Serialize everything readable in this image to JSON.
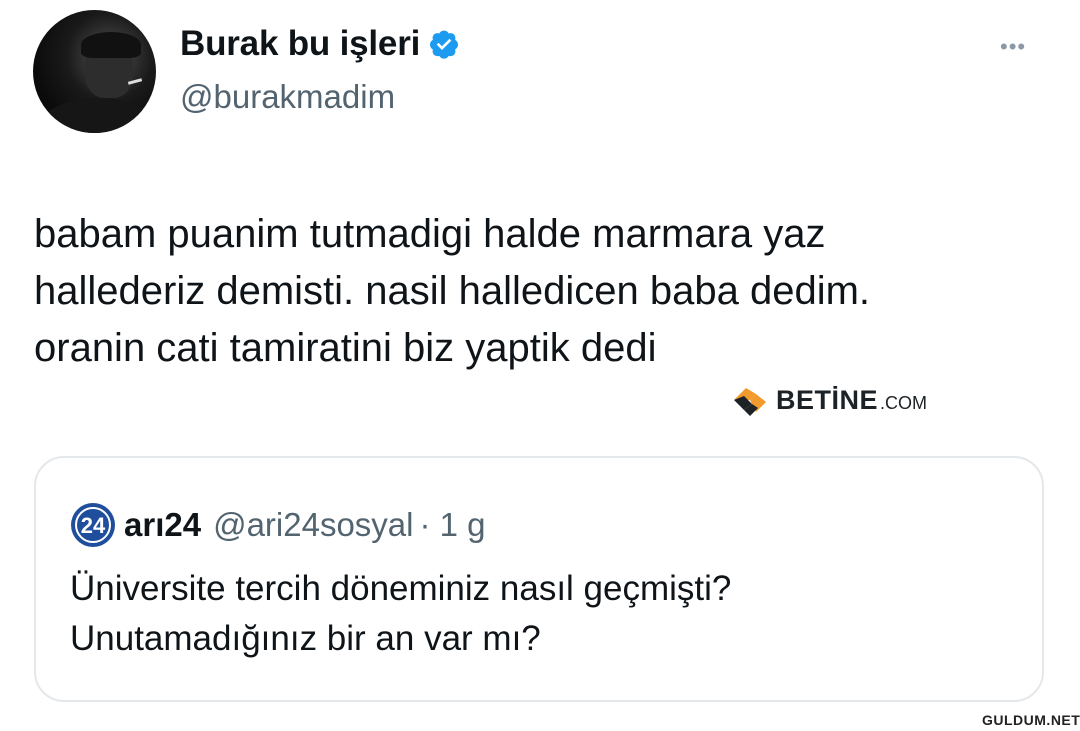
{
  "author": {
    "display_name": "Burak bu işleri",
    "handle": "@burakmadim",
    "verified": true,
    "more_label": "•••"
  },
  "tweet": {
    "lines": [
      "babam puanim tutmadigi halde marmara yaz",
      "hallederiz demisti. nasil halledicen baba dedim.",
      "oranin cati tamiratini biz yaptik dedi"
    ]
  },
  "watermark": {
    "brand": "BETİNE",
    "domain": ".COM"
  },
  "quoted": {
    "logo_text": "24",
    "display_name": "arı24",
    "handle": "@ari24sosyal",
    "time": "· 1 g",
    "lines": [
      "Üniversite tercih döneminiz nasıl geçmişti?",
      "Unutamadığınız bir an var mı?"
    ]
  },
  "corner_watermark": "GULDUM.NET",
  "colors": {
    "verified": "#1d9bf0",
    "muted": "#536471",
    "logo_blue": "#1f4e9c"
  }
}
